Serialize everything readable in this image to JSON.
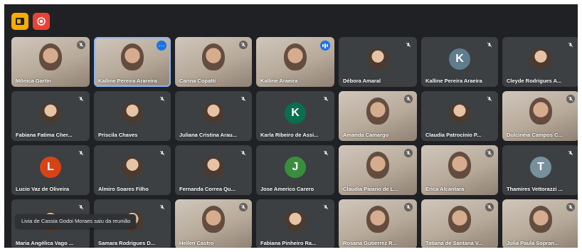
{
  "colors": {
    "background": "#202124",
    "tile": "#3c4043",
    "accent": "#1a73e8",
    "layout_icon_bg": "#f9ab00",
    "record_icon_bg": "#ea4335"
  },
  "toolbar": {
    "layout_icon": "layout-icon",
    "record_icon": "record-icon"
  },
  "participants": [
    {
      "name": "Mônica Gartin",
      "type": "photo",
      "muted": true
    },
    {
      "name": "Kalline Pereira Arareira",
      "type": "photo",
      "speaking": true,
      "more": true
    },
    {
      "name": "Carina Copatti",
      "type": "photo",
      "muted": true
    },
    {
      "name": "Kalline Araeira",
      "type": "photo",
      "speaking_indicator": true
    },
    {
      "name": "Débora Amaral",
      "type": "avatar-pic",
      "muted": true
    },
    {
      "name": "Kalline Pereira Araeira",
      "type": "initial",
      "initial": "K",
      "color": "#5f7d8c",
      "muted": true
    },
    {
      "name": "Cleyde Rodrigues A...",
      "type": "avatar-pic",
      "muted": true
    },
    {
      "name": "Fabiana Fatima Cher...",
      "type": "avatar-pic",
      "muted": true
    },
    {
      "name": "Priscila Chaves",
      "type": "avatar-pic",
      "muted": true
    },
    {
      "name": "Juliana Cristina Arau...",
      "type": "avatar-pic",
      "muted": true
    },
    {
      "name": "Karla Ribeiro de Assi...",
      "type": "initial",
      "initial": "K",
      "color": "#0b6e4f",
      "muted": true
    },
    {
      "name": "Amanda Camargo",
      "type": "photo",
      "muted": true
    },
    {
      "name": "Claudia Patrocinio P...",
      "type": "avatar-pic",
      "muted": true
    },
    {
      "name": "Dulcinéia Campos C...",
      "type": "photo",
      "muted": true
    },
    {
      "name": "Lucio Vaz de Oliveira",
      "type": "initial",
      "initial": "L",
      "color": "#d84315",
      "muted": true
    },
    {
      "name": "Almiro Soares Filho",
      "type": "avatar-pic",
      "muted": true
    },
    {
      "name": "Fernanda Correa Qu...",
      "type": "avatar-pic",
      "muted": true
    },
    {
      "name": "Jose Americo Carero",
      "type": "initial",
      "initial": "J",
      "color": "#388e3c",
      "muted": true
    },
    {
      "name": "Claudia Paiano de L...",
      "type": "photo",
      "muted": true
    },
    {
      "name": "Erica Alcantara",
      "type": "photo",
      "muted": true
    },
    {
      "name": "Thamires Vettorazzi ...",
      "type": "initial",
      "initial": "T",
      "color": "#78909c",
      "muted": true
    },
    {
      "name": "Maria Angélica Vago ...",
      "type": "avatar-pic",
      "muted": true
    },
    {
      "name": "Samara Rodrigues D...",
      "type": "avatar-pic",
      "muted": true
    },
    {
      "name": "Hellen Castro",
      "type": "photo",
      "muted": true
    },
    {
      "name": "Fabiana Pinheiro Ra...",
      "type": "avatar-pic",
      "muted": true
    },
    {
      "name": "Rosana Gutierrez R...",
      "type": "photo",
      "muted": true
    },
    {
      "name": "Tatiana de Santana V...",
      "type": "photo",
      "muted": true
    },
    {
      "name": "Julia Paula Sopran...",
      "type": "photo",
      "muted": true
    }
  ],
  "notification": "Livia de Cassia Godoi Moraes saiu da reunião"
}
